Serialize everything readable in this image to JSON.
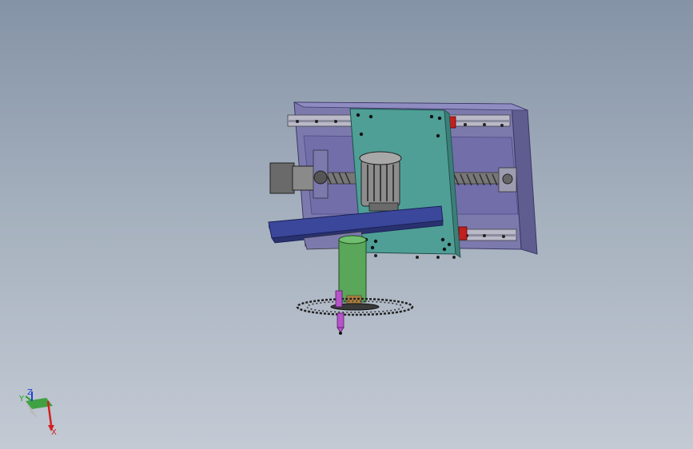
{
  "viewport": {
    "background_top": "#8493a6",
    "background_bottom": "#c3cad4"
  },
  "model": {
    "colors": {
      "base_plate": "#7c79ad",
      "base_plate_dark": "#5f5c8f",
      "carriage_plate": "#4f9f97",
      "table_plate": "#3b479a",
      "spindle": "#5aa65a",
      "motor": "#9a9a9a",
      "stop_block": "#c02020",
      "tool": "#b455c8",
      "blade": "#2a2a2a"
    },
    "parts": [
      "base-plate",
      "linear-rail-top",
      "linear-rail-bottom",
      "ball-screw",
      "servo-motor",
      "carriage-plate",
      "drive-motor",
      "table-plate",
      "spindle",
      "saw-blade",
      "cutting-tool"
    ]
  },
  "triad": {
    "x_label": "X",
    "y_label": "Y",
    "z_label": "Z",
    "x_color": "#d42020",
    "y_color": "#20a020",
    "z_color": "#2040d0"
  }
}
